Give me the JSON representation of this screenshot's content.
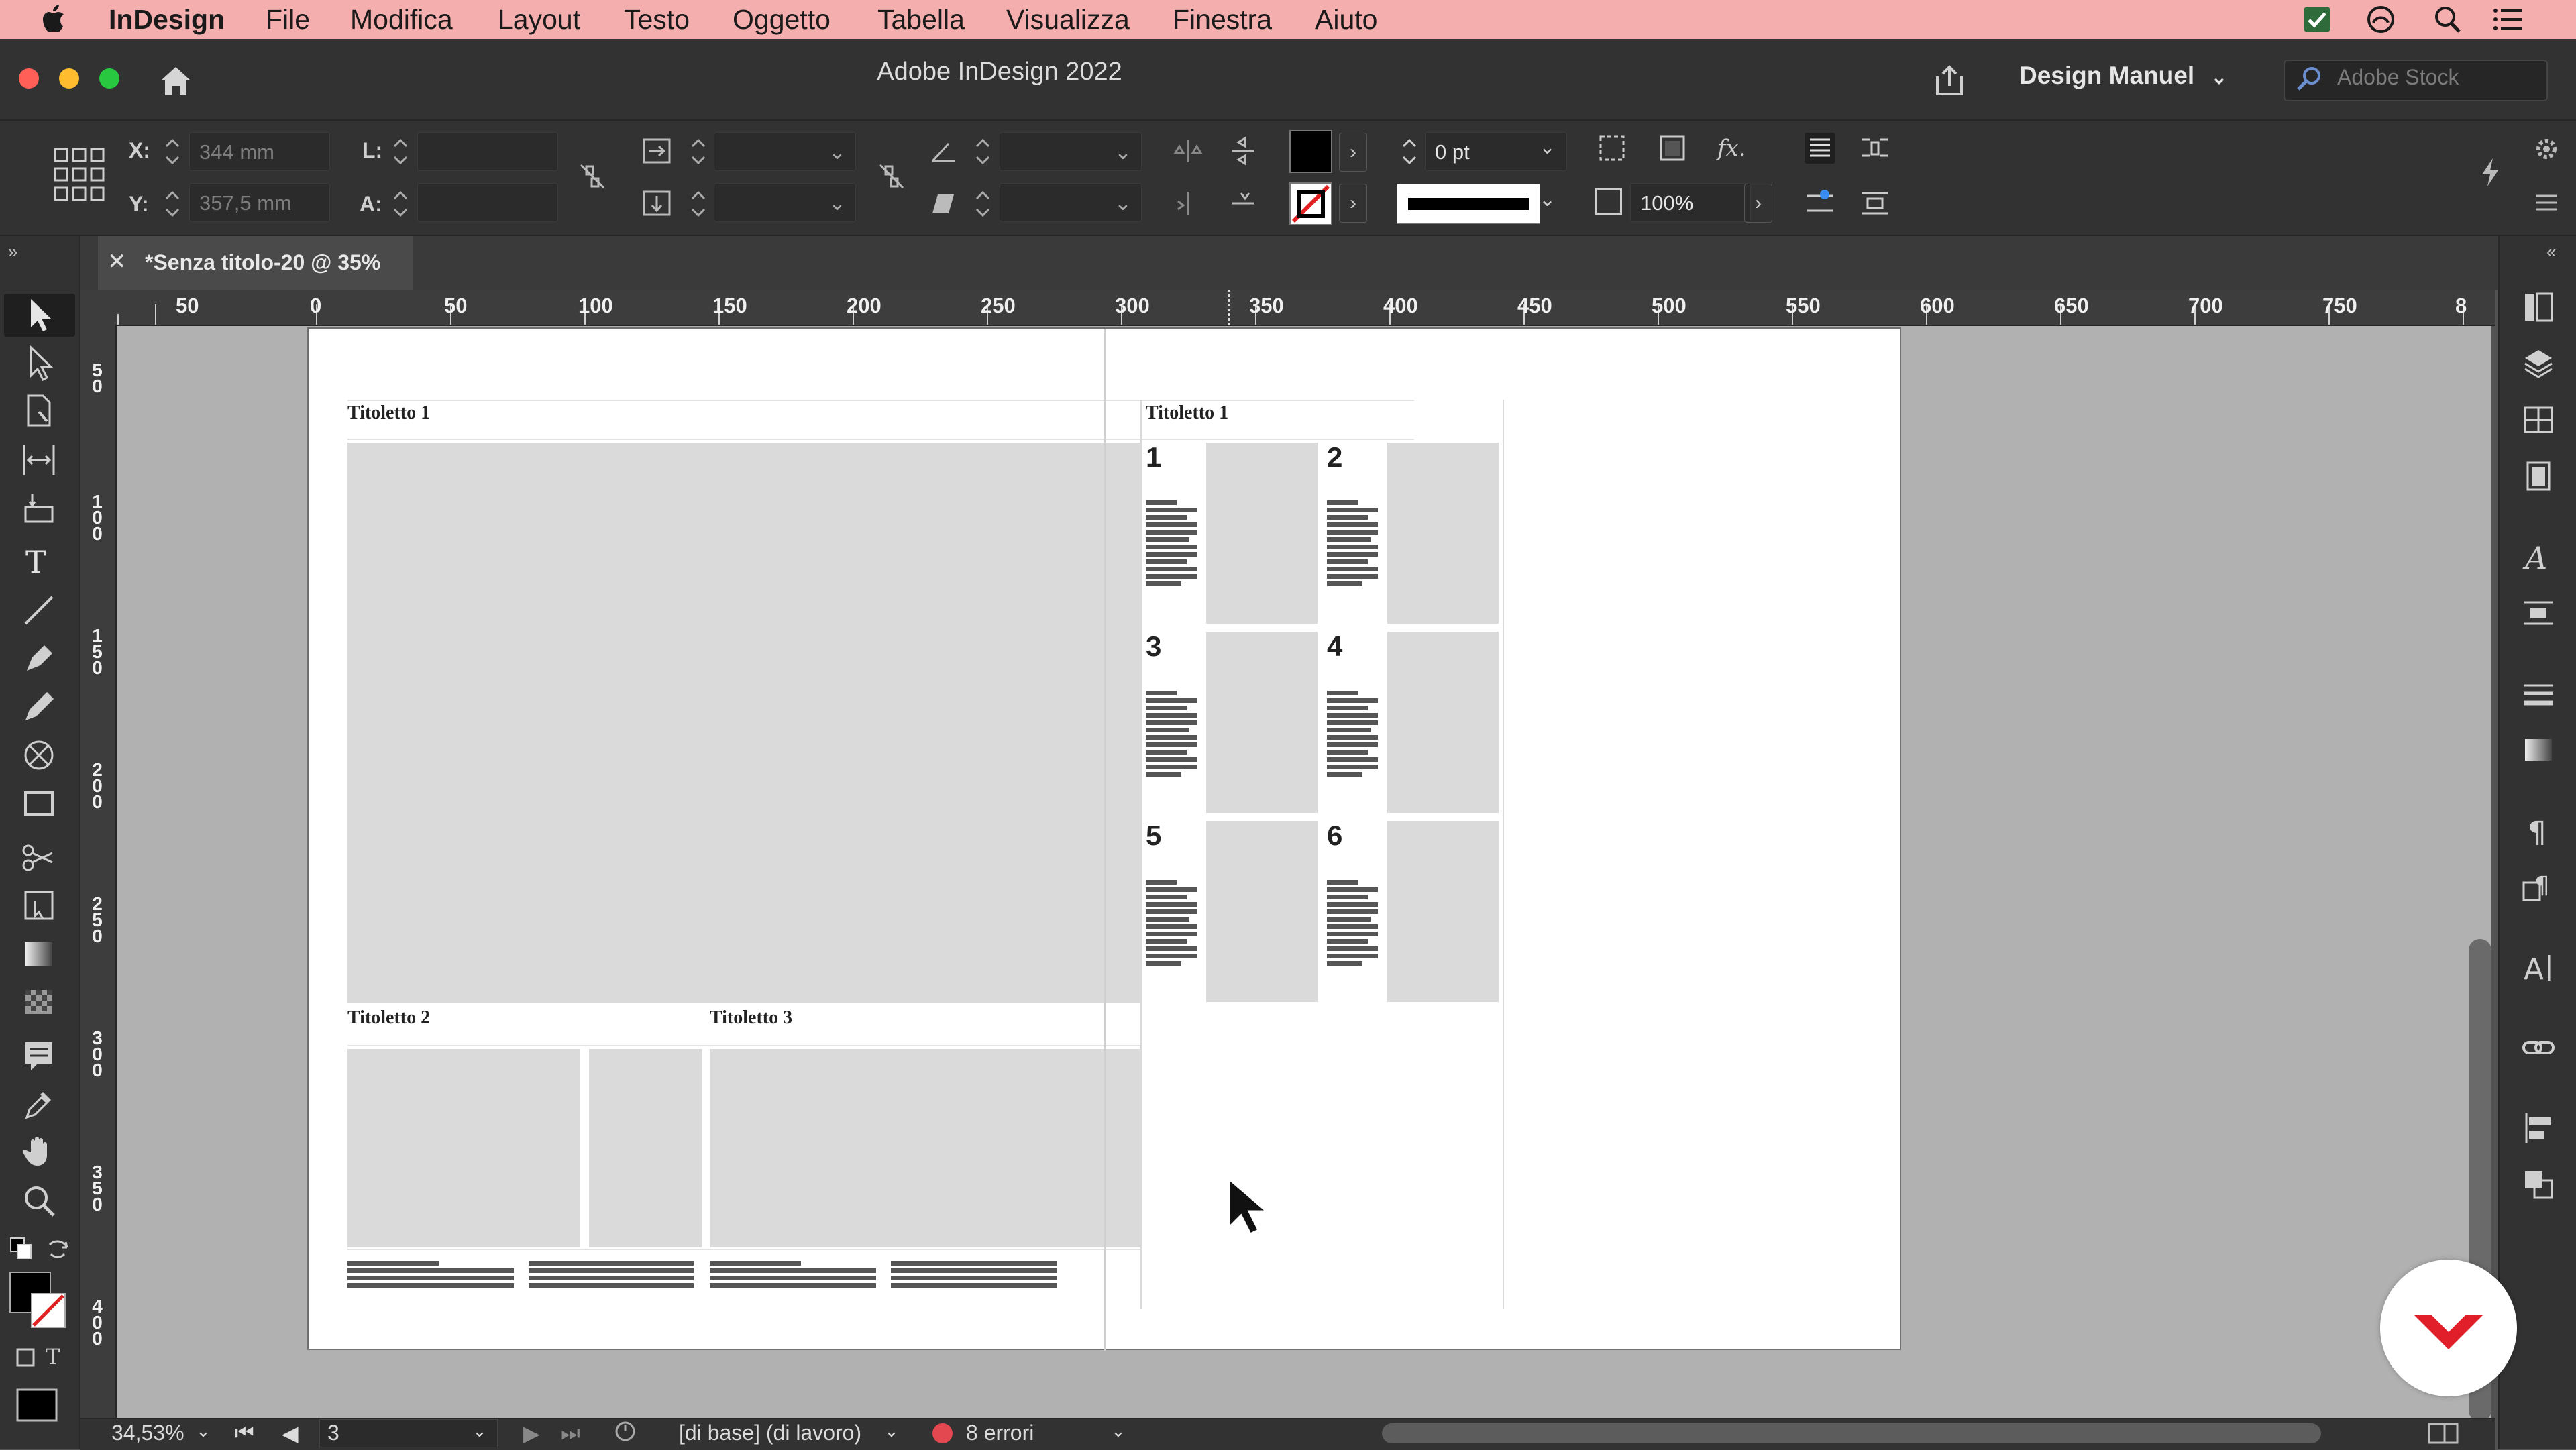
{
  "menubar": {
    "app_name": "InDesign",
    "items": [
      "File",
      "Modifica",
      "Layout",
      "Testo",
      "Oggetto",
      "Tabella",
      "Visualizza",
      "Finestra",
      "Aiuto"
    ]
  },
  "window": {
    "title": "Adobe InDesign 2022",
    "workspace": "Design Manuel",
    "stock_placeholder": "Adobe Stock"
  },
  "control": {
    "x_label": "X:",
    "x_value": "344 mm",
    "y_label": "Y:",
    "y_value": "357,5 mm",
    "l_label": "L:",
    "a_label": "A:",
    "stroke_weight": "0 pt",
    "opacity": "100%"
  },
  "document": {
    "tab_title": "*Senza titolo-20 @ 35%"
  },
  "ruler": {
    "h_labels": [
      "50",
      "0",
      "50",
      "100",
      "150",
      "200",
      "250",
      "300",
      "350",
      "400",
      "450",
      "500",
      "550",
      "600",
      "650",
      "700",
      "750",
      "8"
    ],
    "v_labels": [
      "5\n0",
      "1\n0\n0",
      "1\n5\n0",
      "2\n0\n0",
      "2\n5\n0",
      "3\n0\n0",
      "3\n5\n0",
      "4\n0\n0"
    ]
  },
  "layout": {
    "left_title": "Titoletto 1",
    "right_title": "Titoletto 1",
    "bottom_title_1": "Titoletto 2",
    "bottom_title_2": "Titoletto 3",
    "grid_numbers": [
      "1",
      "2",
      "3",
      "4",
      "5",
      "6"
    ]
  },
  "status": {
    "zoom": "34,53%",
    "page_number": "3",
    "base_label": "[di base] (di lavoro)",
    "errors": "8 errori"
  },
  "colors": {
    "menubar_bg": "#f5aeae",
    "panel_bg": "#323232",
    "pasteboard": "#b1b1b1",
    "error_dot": "#e34850",
    "badge_red": "#e01f2a"
  },
  "icons": [
    "apple-icon",
    "home-icon",
    "share-icon",
    "search-icon",
    "selection-tool-icon",
    "direct-selection-icon",
    "type-tool-icon",
    "pen-tool-icon",
    "rectangle-tool-icon",
    "hand-tool-icon",
    "zoom-tool-icon"
  ]
}
